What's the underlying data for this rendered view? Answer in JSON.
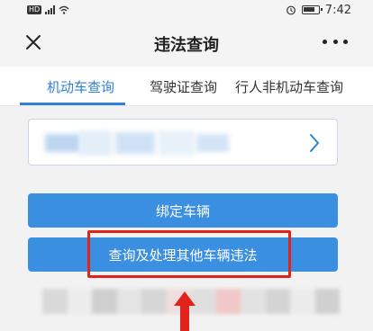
{
  "status_bar": {
    "sim_label": "HD",
    "time": "7:42"
  },
  "nav": {
    "title": "违法查询",
    "close_icon": "close-icon",
    "more_icon": "more-icon"
  },
  "tabs": [
    {
      "label": "机动车查询",
      "active": true
    },
    {
      "label": "驾驶证查询",
      "active": false
    },
    {
      "label": "行人非机动车查询",
      "active": false
    }
  ],
  "plate_card": {
    "chevron_icon": "chevron-right-icon"
  },
  "buttons": {
    "bind_vehicle": "绑定车辆",
    "query_other": "查询及处理其他车辆违法"
  },
  "colors": {
    "accent": "#2f80d6",
    "button": "#3a8fe0",
    "highlight": "#e2231a"
  }
}
